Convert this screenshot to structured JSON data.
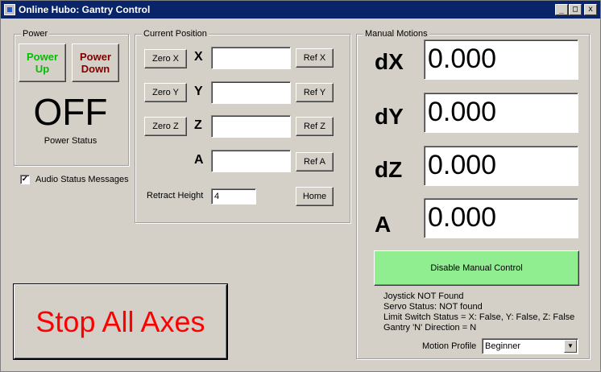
{
  "window": {
    "title": "Online Hubo: Gantry Control",
    "controls": {
      "minimize": "_",
      "maximize": "□",
      "close": "x"
    }
  },
  "power": {
    "group_label": "Power",
    "power_up_label_line1": "Power",
    "power_up_label_line2": "Up",
    "power_down_label_line1": "Power",
    "power_down_label_line2": "Down",
    "status_value": "OFF",
    "status_label": "Power Status",
    "colors": {
      "power_up": "#00c000",
      "power_down": "#800000"
    }
  },
  "audio": {
    "checked": true,
    "label": "Audio Status Messages"
  },
  "current_position": {
    "group_label": "Current Position",
    "rows": [
      {
        "zero_label": "Zero X",
        "axis": "X",
        "value": "",
        "ref_label": "Ref X"
      },
      {
        "zero_label": "Zero Y",
        "axis": "Y",
        "value": "",
        "ref_label": "Ref Y"
      },
      {
        "zero_label": "Zero Z",
        "axis": "Z",
        "value": "",
        "ref_label": "Ref Z"
      },
      {
        "zero_label": "",
        "axis": "A",
        "value": "",
        "ref_label": "Ref A"
      }
    ],
    "retract_label": "Retract Height",
    "retract_value": "4",
    "home_label": "Home"
  },
  "stop": {
    "label": "Stop All Axes",
    "color": "#ff0000"
  },
  "manual": {
    "group_label": "Manual Motions",
    "axes": [
      {
        "label": "dX",
        "value": "0.000"
      },
      {
        "label": "dY",
        "value": "0.000"
      },
      {
        "label": "dZ",
        "value": "0.000"
      },
      {
        "label": "A",
        "value": "0.000"
      }
    ],
    "disable_label": "Disable Manual Control",
    "disable_color": "#90ee90",
    "status_lines": [
      "Joystick NOT Found",
      "Servo Status: NOT found",
      "Limit Switch Status = X: False, Y: False, Z: False",
      "Gantry 'N' Direction = N"
    ],
    "motion_profile_label": "Motion Profile",
    "motion_profile_value": "Beginner"
  }
}
